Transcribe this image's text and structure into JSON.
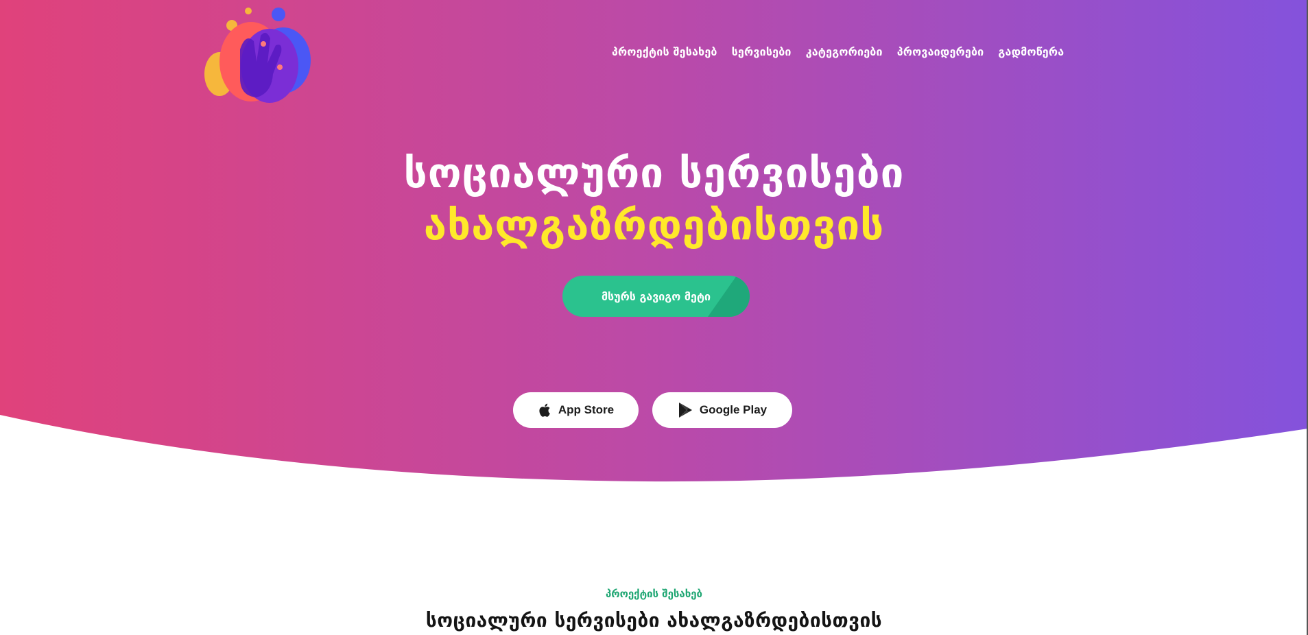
{
  "colors": {
    "gradient_start": "#e0427b",
    "gradient_mid": "#bb4aa8",
    "gradient_end": "#8452dc",
    "accent_yellow": "#ffe92a",
    "cta_green": "#2bc28e",
    "section_label_green": "#1ea672"
  },
  "logo": {
    "icon": "hand-logo-icon"
  },
  "nav": {
    "items": [
      {
        "label": "პროექტის შესახებ"
      },
      {
        "label": "სერვისები"
      },
      {
        "label": "კატეგორიები"
      },
      {
        "label": "პროვაიდერები"
      },
      {
        "label": "გადმოწერა"
      }
    ]
  },
  "hero": {
    "title_line1": "სოციალური სერვისები",
    "title_line2": "ახალგაზრდებისთვის",
    "cta_label": "მსურს გავიგო მეტი"
  },
  "stores": {
    "app_store": {
      "label": "App Store",
      "icon": "apple-icon"
    },
    "google_play": {
      "label": "Google Play",
      "icon": "google-play-icon"
    }
  },
  "about": {
    "label": "პროექტის შესახებ",
    "title": "სოციალური სერვისები ახალგაზრდებისთვის"
  }
}
